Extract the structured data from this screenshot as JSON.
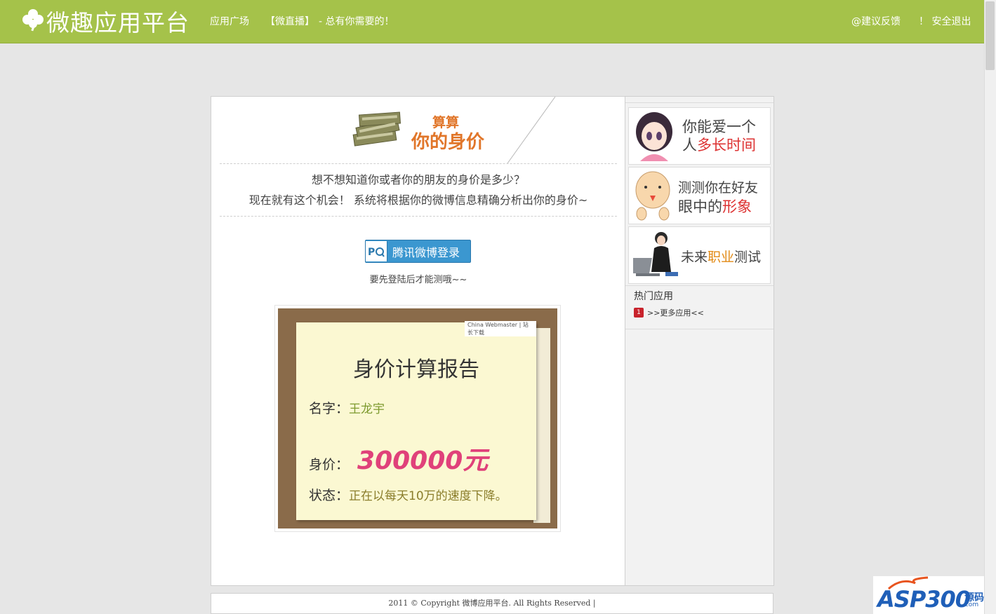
{
  "header": {
    "logo_text": "微趣应用平台",
    "nav_apps": "应用广场",
    "nav_live": "【微直播】",
    "nav_live_tail": "- 总有你需要的！",
    "feedback": "@建议反馈",
    "logout": "！ 安全退出"
  },
  "banner": {
    "line1": "算算",
    "line2": "你的身价"
  },
  "intro": {
    "line1": "想不想知道你或者你的朋友的身价是多少？",
    "line2": "现在就有这个机会！ 系统将根据你的微博信息精确分析出你的身价~"
  },
  "login": {
    "button_label": "腾讯微博登录",
    "tip": "要先登陆后才能测哦~~"
  },
  "report": {
    "watermark": "China Webmaster | 站长下载",
    "title": "身价计算报告",
    "name_label": "名字：",
    "name_value": "王龙宇",
    "worth_label": "身价：",
    "worth_value": "300000元",
    "status_label": "状态：",
    "status_value": "正在以每天10万的速度下降。"
  },
  "sidebar": {
    "cards": [
      {
        "line1": "你能爱一个",
        "line2a": "人",
        "line2b": "多长时间"
      },
      {
        "line1": "测测你在好友",
        "line2a": "眼中的",
        "line2b": "形象"
      },
      {
        "line1a": "未来",
        "line1b": "职业",
        "line1c": "测试"
      }
    ],
    "hot_title": "热门应用",
    "hot_badge": "1",
    "more_link": ">>更多应用<<"
  },
  "footer": {
    "copyright": "2011 © Copyright 微博应用平台. All Rights Reserved |"
  },
  "watermark_logo": {
    "text": "ASP300",
    "sub": "源码",
    "com": ".com"
  },
  "colors": {
    "header_green": "#a5c24a",
    "accent_orange": "#e1762a",
    "login_blue": "#3b97d0",
    "worth_pink": "#e0417a"
  }
}
